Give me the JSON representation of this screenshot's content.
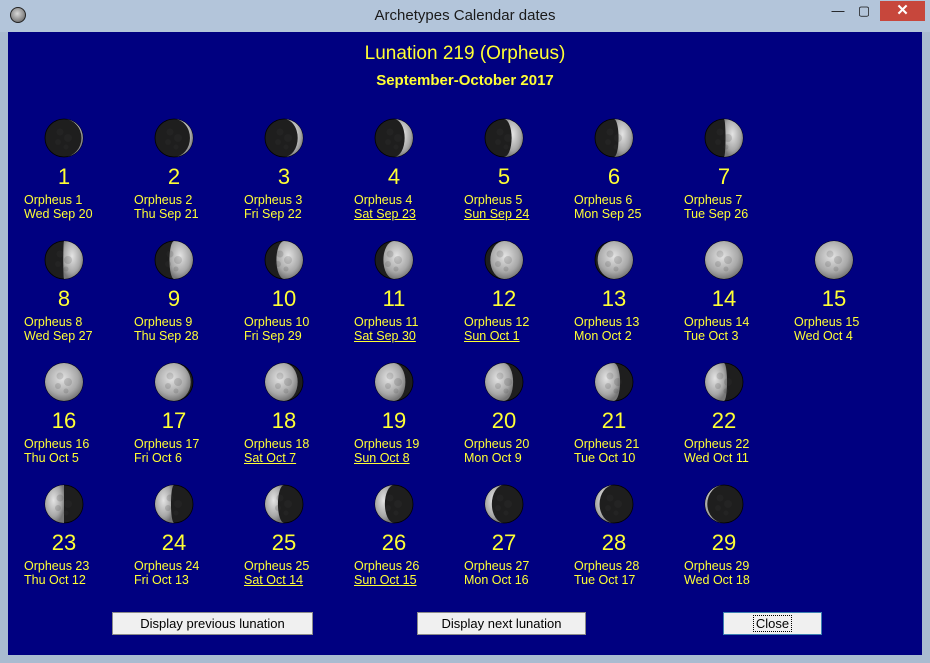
{
  "window": {
    "title": "Archetypes Calendar dates",
    "minimize_glyph": "—",
    "maximize_glyph": "▢",
    "close_glyph": "✕"
  },
  "header": {
    "lunation": "Lunation 219 (Orpheus)",
    "months": "September-October 2017"
  },
  "days": [
    {
      "num": "1",
      "name": "Orpheus 1",
      "date": "Wed Sep 20",
      "underline": false,
      "phase": "new"
    },
    {
      "num": "2",
      "name": "Orpheus 2",
      "date": "Thu Sep 21",
      "underline": false,
      "phase": "crescent-1"
    },
    {
      "num": "3",
      "name": "Orpheus 3",
      "date": "Fri Sep 22",
      "underline": false,
      "phase": "crescent-2"
    },
    {
      "num": "4",
      "name": "Orpheus 4",
      "date": "Sat Sep 23",
      "underline": true,
      "phase": "crescent-3"
    },
    {
      "num": "5",
      "name": "Orpheus 5",
      "date": "Sun Sep 24",
      "underline": true,
      "phase": "crescent-4"
    },
    {
      "num": "6",
      "name": "Orpheus 6",
      "date": "Mon Sep 25",
      "underline": false,
      "phase": "crescent-5"
    },
    {
      "num": "7",
      "name": "Orpheus 7",
      "date": "Tue Sep 26",
      "underline": false,
      "phase": "crescent-6"
    },
    {
      "num": "8",
      "name": "Orpheus 8",
      "date": "Wed Sep 27",
      "underline": false,
      "phase": "first-quarter"
    },
    {
      "num": "9",
      "name": "Orpheus 9",
      "date": "Thu Sep 28",
      "underline": false,
      "phase": "gibbous-1"
    },
    {
      "num": "10",
      "name": "Orpheus 10",
      "date": "Fri Sep 29",
      "underline": false,
      "phase": "gibbous-2"
    },
    {
      "num": "11",
      "name": "Orpheus 11",
      "date": "Sat Sep 30",
      "underline": true,
      "phase": "gibbous-3"
    },
    {
      "num": "12",
      "name": "Orpheus 12",
      "date": "Sun Oct 1",
      "underline": true,
      "phase": "gibbous-4"
    },
    {
      "num": "13",
      "name": "Orpheus 13",
      "date": "Mon Oct 2",
      "underline": false,
      "phase": "gibbous-5"
    },
    {
      "num": "14",
      "name": "Orpheus 14",
      "date": "Tue Oct 3",
      "underline": false,
      "phase": "full"
    },
    {
      "num": "15",
      "name": "Orpheus 15",
      "date": "Wed Oct 4",
      "underline": false,
      "phase": "full"
    },
    {
      "num": "16",
      "name": "Orpheus 16",
      "date": "Thu Oct 5",
      "underline": false,
      "phase": "full"
    },
    {
      "num": "17",
      "name": "Orpheus 17",
      "date": "Fri Oct 6",
      "underline": false,
      "phase": "wgibbous-1"
    },
    {
      "num": "18",
      "name": "Orpheus 18",
      "date": "Sat Oct 7",
      "underline": true,
      "phase": "wgibbous-2"
    },
    {
      "num": "19",
      "name": "Orpheus 19",
      "date": "Sun Oct 8",
      "underline": true,
      "phase": "wgibbous-3"
    },
    {
      "num": "20",
      "name": "Orpheus 20",
      "date": "Mon Oct 9",
      "underline": false,
      "phase": "wgibbous-4"
    },
    {
      "num": "21",
      "name": "Orpheus 21",
      "date": "Tue Oct 10",
      "underline": false,
      "phase": "wgibbous-5"
    },
    {
      "num": "22",
      "name": "Orpheus 22",
      "date": "Wed Oct 11",
      "underline": false,
      "phase": "wgibbous-6"
    },
    {
      "num": "23",
      "name": "Orpheus 23",
      "date": "Thu Oct 12",
      "underline": false,
      "phase": "last-quarter"
    },
    {
      "num": "24",
      "name": "Orpheus 24",
      "date": "Fri Oct 13",
      "underline": false,
      "phase": "wcrescent-1"
    },
    {
      "num": "25",
      "name": "Orpheus 25",
      "date": "Sat Oct 14",
      "underline": true,
      "phase": "wcrescent-2"
    },
    {
      "num": "26",
      "name": "Orpheus 26",
      "date": "Sun Oct 15",
      "underline": true,
      "phase": "wcrescent-3"
    },
    {
      "num": "27",
      "name": "Orpheus 27",
      "date": "Mon Oct 16",
      "underline": false,
      "phase": "wcrescent-4"
    },
    {
      "num": "28",
      "name": "Orpheus 28",
      "date": "Tue Oct 17",
      "underline": false,
      "phase": "wcrescent-5"
    },
    {
      "num": "29",
      "name": "Orpheus 29",
      "date": "Wed Oct 18",
      "underline": false,
      "phase": "wcrescent-6"
    }
  ],
  "buttons": {
    "prev": "Display previous lunation",
    "next": "Display next lunation",
    "close": "Close"
  },
  "colors": {
    "background": "#000080",
    "text": "#ffff33",
    "moon_light": "#c8c8c8",
    "moon_dark": "#1e1e1e"
  }
}
